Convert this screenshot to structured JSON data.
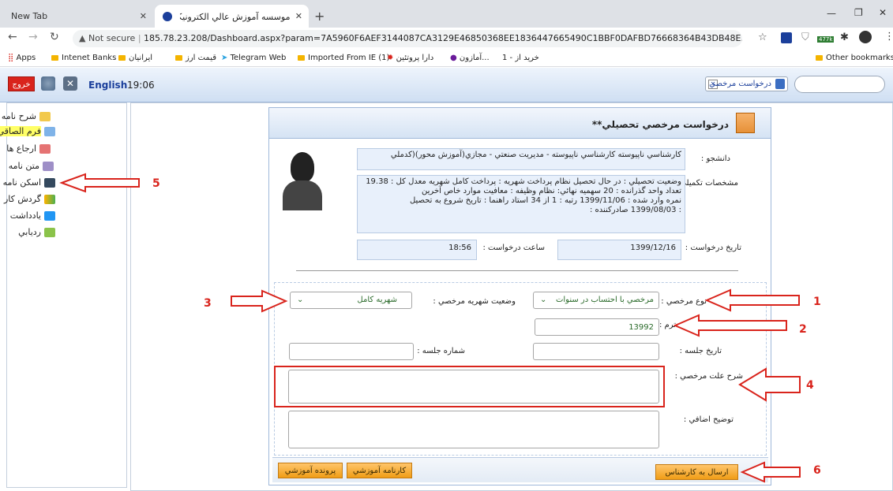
{
  "browser": {
    "tabs": [
      {
        "title": "New Tab"
      },
      {
        "title": "موسسه آموزش عالي الكترونيكي اي..."
      }
    ],
    "address": {
      "security": "Not secure",
      "url": "185.78.23.208/Dashboard.aspx?param=7A5960F6AEF3144087CA3129E46850368EE1836447665490C1BBF0DAFBD76668364B43DB48E35E91328C892B1E35..."
    },
    "extension_badge": "477k",
    "bookmarks": [
      "Apps",
      "Intenet Banks",
      "ايرانيان",
      "قيمت ارز",
      "Telegram Web",
      "Imported From IE (1)",
      "دارا پروتئين",
      "آمازون...",
      "1 - خريد از"
    ],
    "other_bookmarks": "Other bookmarks"
  },
  "header": {
    "exit_label": "خروج",
    "language": "English",
    "time": "19:06",
    "request_pill": "درخواست مرخصي"
  },
  "sidebar": {
    "items": [
      {
        "label": "شرح نامه",
        "icon": "mail-icon",
        "highlight": false
      },
      {
        "label": "فرم الصاقي",
        "icon": "form-icon",
        "highlight": true
      },
      {
        "label": "ارجاع ها",
        "icon": "forward-icon",
        "highlight": false
      },
      {
        "label": "متن نامه",
        "icon": "text-icon",
        "highlight": false
      },
      {
        "label": "اسكن نامه",
        "icon": "scan-icon",
        "highlight": false
      },
      {
        "label": "گردش كار",
        "icon": "workflow-icon",
        "highlight": false
      },
      {
        "label": "يادداشت",
        "icon": "note-icon",
        "highlight": false
      },
      {
        "label": "رديابي",
        "icon": "tracking-icon",
        "highlight": false
      }
    ]
  },
  "form": {
    "title": "درخواست مرخصي تحصيلي**",
    "student_label": "دانشجو :",
    "student_value": "كارشناسي ناپيوسته كارشناسي ناپيوسته - مديريت صنعتي - مجازي(آموزش محور)(كدملي",
    "details_label": "مشخصات تكميلي :",
    "details_lines": [
      "وضعيت تحصيلي : در حال تحصيل  نظام پرداخت شهريه : پرداخت كامل شهريه  معدل كل : 19.38",
      "تعداد واحد گذرانده : 20  سهميه نهائي:  نظام وظيفه : معافيت موارد خاص  آخرين",
      "نمره وارد شده : 1399/11/06  رتبه : 1 از 34  استاد راهنما :  تاريخ شروع به تحصيل",
      ": 1399/08/03  صادركننده :"
    ],
    "request_date_label": "تاريخ درخواست :",
    "request_date": "1399/12/16",
    "request_time_label": "ساعت درخواست :",
    "request_time": "18:56",
    "leave_type_label": "نوع مرخصي :",
    "leave_type_value": "مرخصي با احتساب در سنوات",
    "fee_status_label": "وضعيت شهريه مرخصي :",
    "fee_status_value": "شهريه كامل",
    "term_label": "ترم :",
    "term_value": "13992",
    "meeting_date_label": "تاريخ جلسه :",
    "meeting_no_label": "شماره جلسه :",
    "reason_label": "شرح علت مرخصي :",
    "extra_label": "توضيح اضافي :",
    "send_button": "ارسال به كارشناس",
    "transcript_button": "كارنامه آموزشي",
    "file_button": "پرونده آموزشي"
  },
  "annotations": [
    "1",
    "2",
    "3",
    "4",
    "5",
    "6"
  ],
  "colors": {
    "accent_red": "#d9241c",
    "button_orange": "#f09d16",
    "highlight_yellow": "#ffff66"
  }
}
